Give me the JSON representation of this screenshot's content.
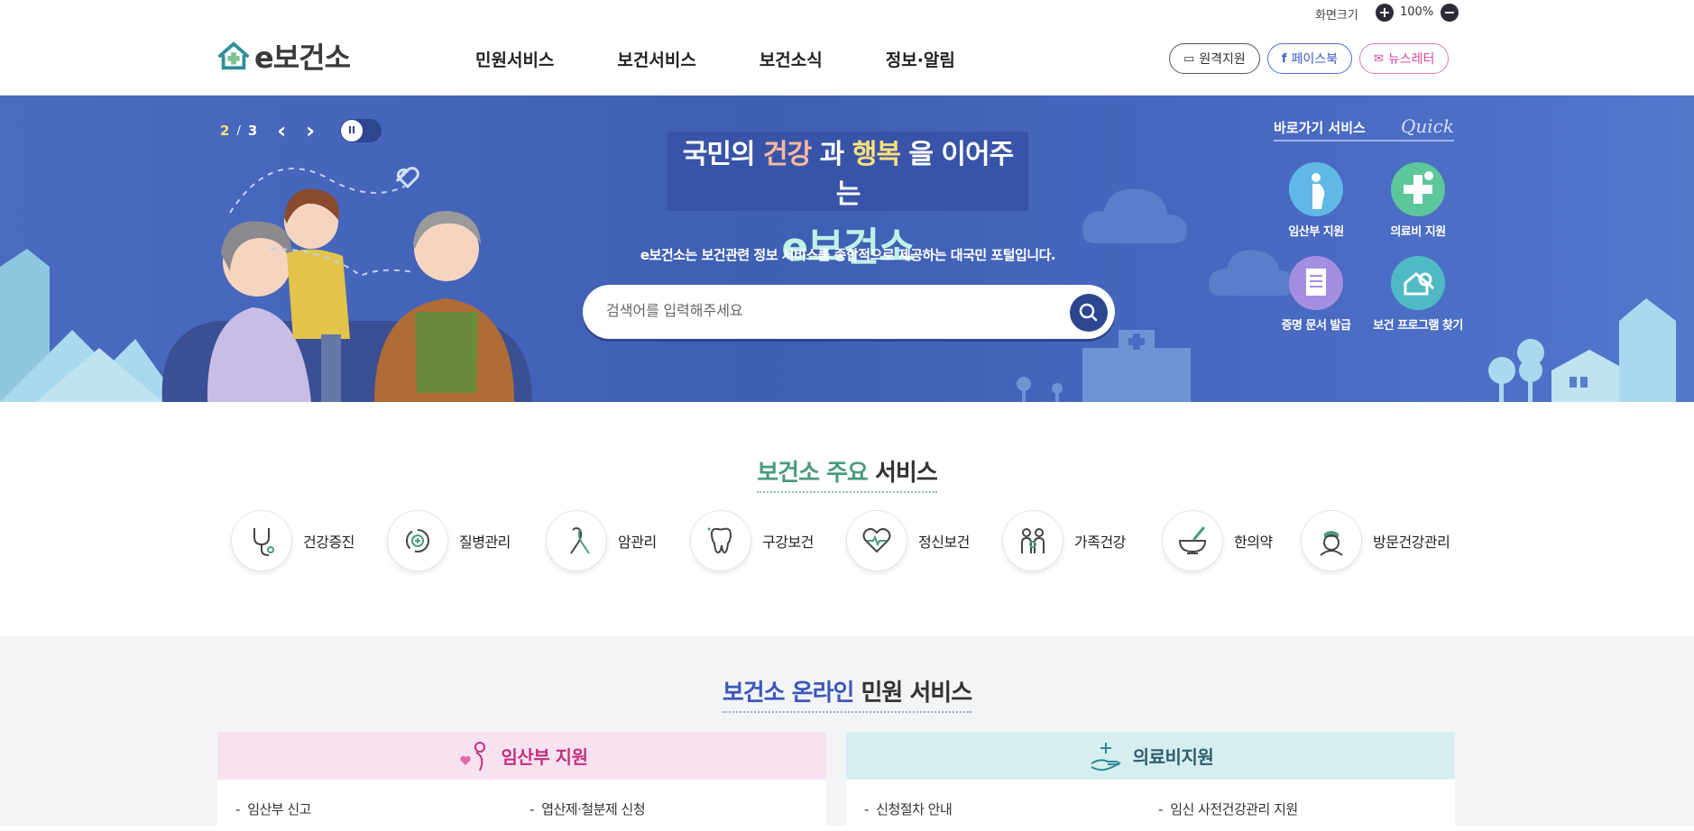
{
  "util": {
    "screen_size_label": "화면크기",
    "zoom": "100%",
    "zoom_in_icon": "+",
    "zoom_out_icon": "−"
  },
  "header": {
    "logo": "e보건소",
    "nav": [
      "민원서비스",
      "보건서비스",
      "보건소식",
      "정보·알림"
    ],
    "buttons": {
      "remote": "원격지원",
      "facebook": "페이스북",
      "newsletter": "뉴스레터"
    }
  },
  "hero": {
    "slide_current": "2",
    "slide_sep": "/",
    "slide_total": "3",
    "title_part1": "국민의 ",
    "title_hl1": "건강",
    "title_part2": " 과 ",
    "title_hl2": "행복",
    "title_part3": " 을 이어주는",
    "title_line2": "e보건소",
    "description": "e보건소는 보건관련 정보 서비스를 종합적으로 제공하는 대국민 포털입니다.",
    "search_placeholder": "검색어를 입력해주세요",
    "quick": {
      "title": "바로가기 서비스",
      "script": "Quick",
      "items": [
        "임산부 지원",
        "의료비 지원",
        "증명 문서 발급",
        "보건 프로그램 찾기"
      ]
    }
  },
  "main_services": {
    "title_accent": "보건소 주요",
    "title_rest": " 서비스",
    "items": [
      "건강증진",
      "질병관리",
      "암관리",
      "구강보건",
      "정신보건",
      "가족건강",
      "한의약",
      "방문건강관리"
    ]
  },
  "online_services": {
    "title_accent": "보건소 온라인",
    "title_rest": " 민원 서비스",
    "panels": [
      {
        "title": "임산부 지원",
        "links": [
          "임산부 신고",
          "엽산제·철분제 신청"
        ]
      },
      {
        "title": "의료비지원",
        "links": [
          "신청절차 안내",
          "임신 사전건강관리 지원"
        ]
      }
    ]
  },
  "colors": {
    "hero_bg": "#4565b8",
    "accent_green": "#4a9a82",
    "accent_blue": "#3b57b9",
    "pink": "#c4307f"
  }
}
